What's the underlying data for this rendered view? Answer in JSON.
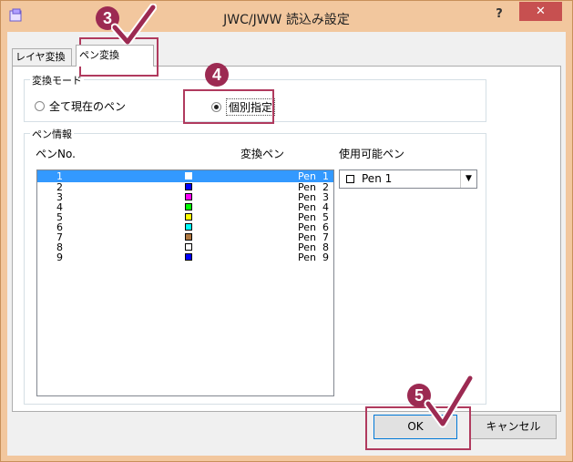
{
  "window": {
    "title": "JWC/JWW 読込み設定",
    "help_label": "?",
    "close_label": "✕"
  },
  "tabs": [
    {
      "label": "レイヤ変換",
      "active": false
    },
    {
      "label": "ペン変換",
      "active": true
    }
  ],
  "mode_group": {
    "legend": "変換モード",
    "options": [
      {
        "label": "全て現在のペン",
        "selected": false
      },
      {
        "label": "個別指定",
        "selected": true
      }
    ]
  },
  "pen_group": {
    "legend": "ペン情報",
    "headers": {
      "no": "ペンNo.",
      "convert": "変換ペン",
      "available": "使用可能ペン"
    },
    "rows": [
      {
        "no": "1",
        "color": "#ffffff",
        "pen": "Pen  1",
        "selected": true
      },
      {
        "no": "2",
        "color": "#0000ff",
        "pen": "Pen  2"
      },
      {
        "no": "3",
        "color": "#ff00ff",
        "pen": "Pen  3"
      },
      {
        "no": "4",
        "color": "#00ff00",
        "pen": "Pen  4"
      },
      {
        "no": "5",
        "color": "#ffff00",
        "pen": "Pen  5"
      },
      {
        "no": "6",
        "color": "#00ffff",
        "pen": "Pen  6"
      },
      {
        "no": "7",
        "color": "#b07840",
        "pen": "Pen  7"
      },
      {
        "no": "8",
        "color": "#ffffff",
        "pen": "Pen  8"
      },
      {
        "no": "9",
        "color": "#0000ff",
        "pen": "Pen  9"
      }
    ],
    "available_pen": {
      "value": "Pen 1",
      "color": "#ffffff"
    }
  },
  "buttons": {
    "ok": "OK",
    "cancel": "キャンセル"
  },
  "callouts": [
    {
      "number": "3"
    },
    {
      "number": "4"
    },
    {
      "number": "5"
    }
  ],
  "colors": {
    "accent": "#9c2a52",
    "selection": "#3399ff",
    "close": "#c75050",
    "frame": "#f2c79e"
  }
}
